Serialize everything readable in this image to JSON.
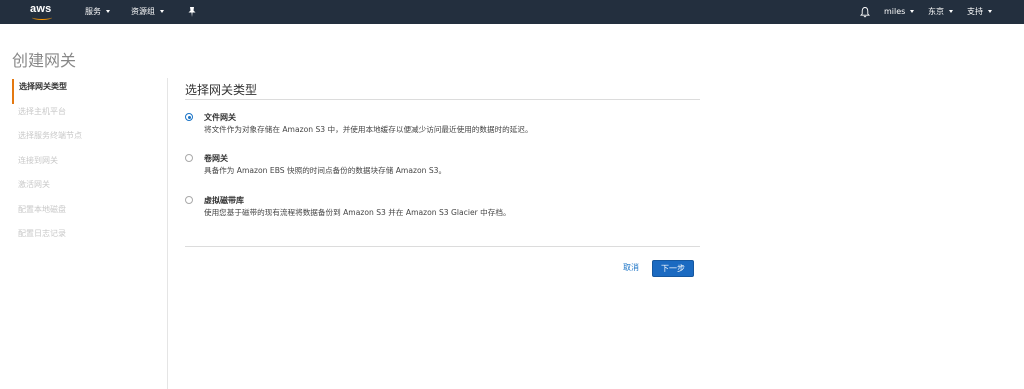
{
  "nav": {
    "logo": "aws",
    "services": "服务",
    "resource_groups": "资源组",
    "user": "miles",
    "region": "东京",
    "support": "支持"
  },
  "page_title": "创建网关",
  "steps": [
    "选择网关类型",
    "选择主机平台",
    "选择服务终端节点",
    "连接到网关",
    "激活网关",
    "配置本地磁盘",
    "配置日志记录"
  ],
  "main": {
    "section_title": "选择网关类型",
    "options": [
      {
        "label": "文件网关",
        "desc": "将文件作为对象存储在 Amazon S3 中，并使用本地缓存以便减少访问最近使用的数据时的延迟。",
        "selected": true
      },
      {
        "label": "卷网关",
        "desc": "具备作为 Amazon EBS 快照的时间点备份的数据块存储 Amazon S3。",
        "selected": false
      },
      {
        "label": "虚拟磁带库",
        "desc": "使用您基于磁带的现有流程将数据备份到 Amazon S3 并在 Amazon S3 Glacier 中存档。",
        "selected": false
      }
    ],
    "cancel": "取消",
    "next": "下一步"
  },
  "colors": {
    "nav_bg": "#232f3e",
    "accent": "#ff9900",
    "primary": "#1b6ac1",
    "active_step": "#e47911"
  },
  "icons": {
    "pin": "pin-icon",
    "bell": "bell-icon"
  }
}
